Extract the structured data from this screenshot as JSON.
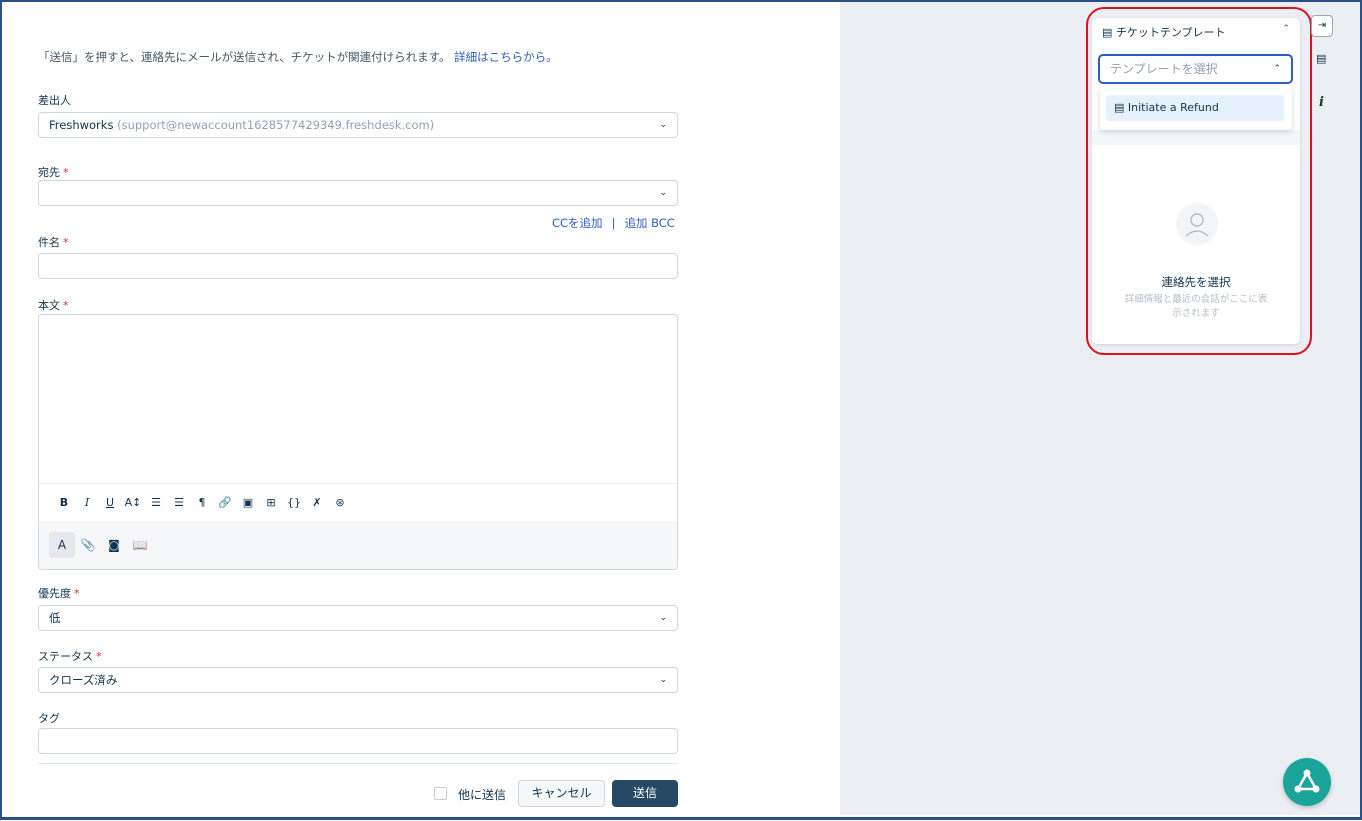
{
  "form": {
    "info_text": "「送信」を押すと、連絡先にメールが送信され、チケットが関連付けられます。",
    "info_link": "詳細はこちらから。",
    "from_label": "差出人",
    "from_value": "Freshworks",
    "from_email": "(support@newaccount1628577429349.freshdesk.com)",
    "to_label": "宛先",
    "add_cc": "CCを追加",
    "cc_sep": "|",
    "add_bcc": "追加 BCC",
    "subject_label": "件名",
    "body_label": "本文",
    "priority_label": "優先度",
    "priority_value": "低",
    "status_label": "ステータス",
    "status_value": "クローズ済み",
    "tags_label": "タグ",
    "required_mark": "*"
  },
  "editor_toolbar": {
    "bold": "B",
    "italic": "I",
    "underline": "U",
    "font_size": "A↕",
    "ordered_list": "☰",
    "unordered_list": "☰",
    "paragraph": "¶",
    "link": "🔗",
    "image": "▣",
    "table": "⊞",
    "code": "{}",
    "clear_format": "✗",
    "more": "⊛",
    "text_style": "A",
    "attach": "📎",
    "screenshot": "◙",
    "canned": "📖"
  },
  "footer": {
    "send_to_others": "他に送信",
    "cancel": "キャンセル",
    "send": "送信"
  },
  "sidebar": {
    "template_header": "チケットテンプレート",
    "template_placeholder": "テンプレートを選択",
    "template_option": "Initiate a Refund",
    "contact_title": "連絡先を選択",
    "contact_subtitle": "詳細情報と最近の会話がここに表示されます",
    "info_icon": "i"
  },
  "colors": {
    "link": "#2c5cc5",
    "primary_button": "#264966",
    "required": "#d72d30",
    "highlight": "#e1101b",
    "fab": "#1ba59a"
  }
}
